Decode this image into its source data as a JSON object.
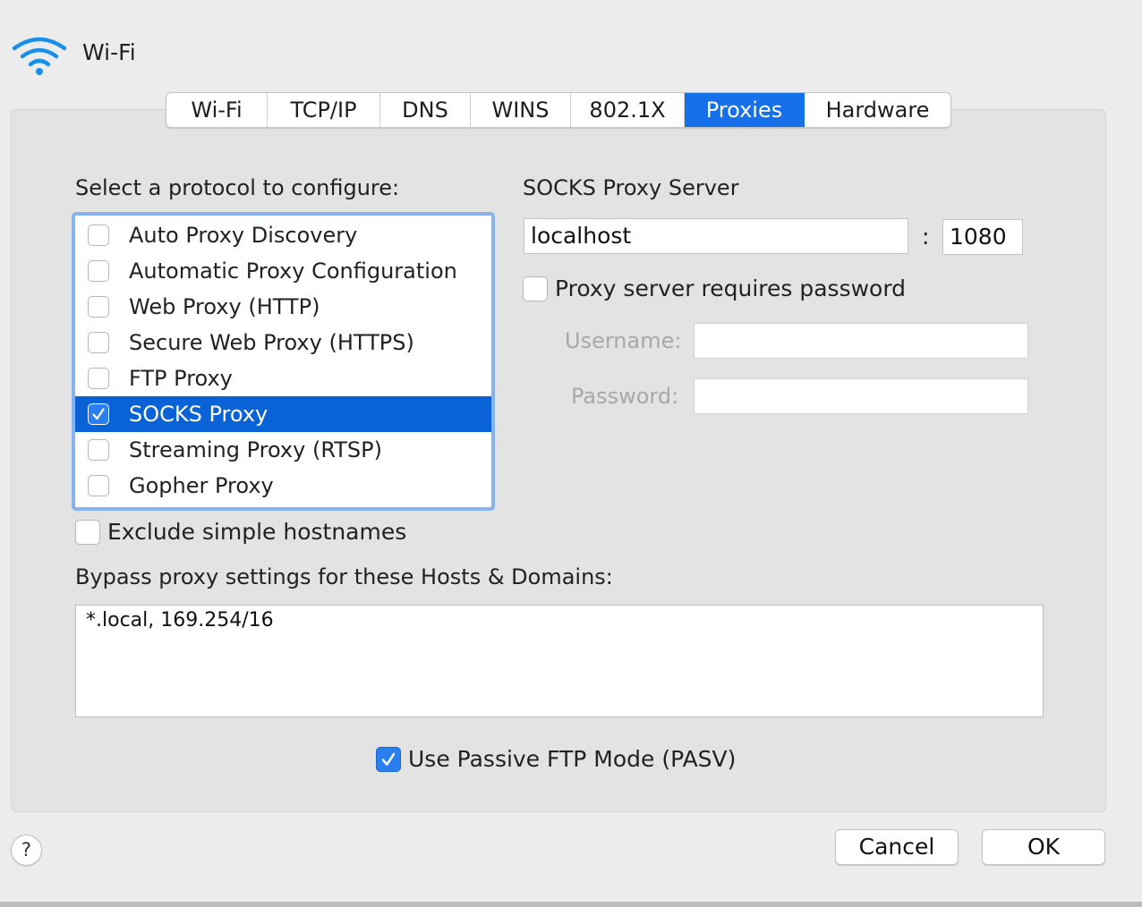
{
  "window": {
    "title": "Wi-Fi"
  },
  "tabs": [
    {
      "label": "Wi-Fi",
      "selected": false
    },
    {
      "label": "TCP/IP",
      "selected": false
    },
    {
      "label": "DNS",
      "selected": false
    },
    {
      "label": "WINS",
      "selected": false
    },
    {
      "label": "802.1X",
      "selected": false
    },
    {
      "label": "Proxies",
      "selected": true
    },
    {
      "label": "Hardware",
      "selected": false
    }
  ],
  "protocols": {
    "heading": "Select a protocol to configure:",
    "items": [
      {
        "label": "Auto Proxy Discovery",
        "checked": false,
        "selected": false
      },
      {
        "label": "Automatic Proxy Configuration",
        "checked": false,
        "selected": false
      },
      {
        "label": "Web Proxy (HTTP)",
        "checked": false,
        "selected": false
      },
      {
        "label": "Secure Web Proxy (HTTPS)",
        "checked": false,
        "selected": false
      },
      {
        "label": "FTP Proxy",
        "checked": false,
        "selected": false
      },
      {
        "label": "SOCKS Proxy",
        "checked": true,
        "selected": true
      },
      {
        "label": "Streaming Proxy (RTSP)",
        "checked": false,
        "selected": false
      },
      {
        "label": "Gopher Proxy",
        "checked": false,
        "selected": false
      }
    ]
  },
  "server": {
    "heading": "SOCKS Proxy Server",
    "host": "localhost",
    "separator": ":",
    "port": "1080",
    "requires_password_label": "Proxy server requires password",
    "requires_password": false,
    "username_label": "Username:",
    "username": "",
    "password_label": "Password:",
    "password": ""
  },
  "exclude_simple_hostnames": {
    "label": "Exclude simple hostnames",
    "checked": false
  },
  "bypass": {
    "label": "Bypass proxy settings for these Hosts & Domains:",
    "value": "*.local, 169.254/16"
  },
  "passive_ftp": {
    "label": "Use Passive FTP Mode (PASV)",
    "checked": true
  },
  "buttons": {
    "help": "?",
    "cancel": "Cancel",
    "ok": "OK"
  },
  "colors": {
    "accent": "#1670e9",
    "selection": "#0a63d6",
    "focus_ring": "#86b3ee"
  }
}
